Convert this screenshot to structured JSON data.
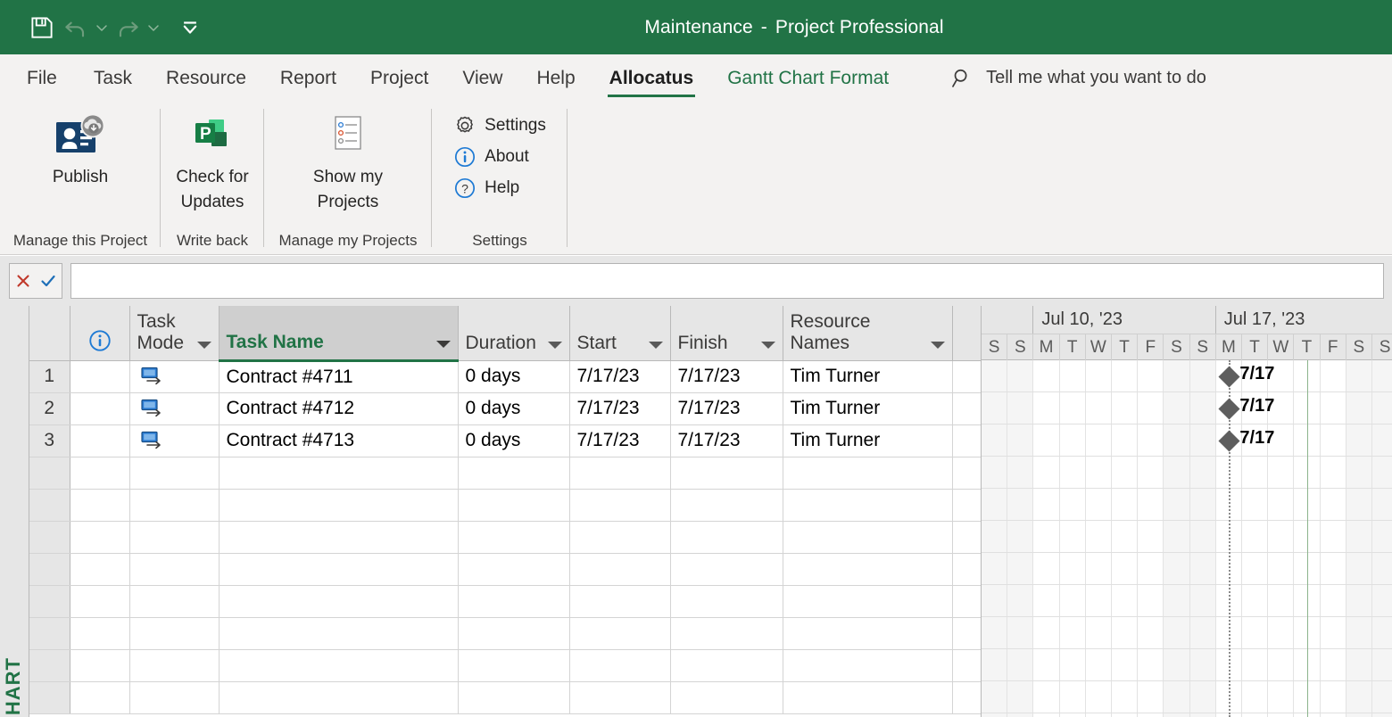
{
  "titlebar": {
    "doc_name": "Maintenance",
    "separator": "-",
    "app_name": "Project Professional",
    "quick_access": [
      {
        "name": "save-button",
        "icon": "save-icon"
      },
      {
        "name": "undo-button",
        "icon": "undo-icon"
      },
      {
        "name": "undo-dropdown",
        "icon": "chevron-down-icon"
      },
      {
        "name": "redo-button",
        "icon": "redo-icon"
      },
      {
        "name": "redo-dropdown",
        "icon": "chevron-down-icon"
      },
      {
        "name": "customize-quick-access-toolbar",
        "icon": "overflow-chevron-icon"
      }
    ]
  },
  "tabs": [
    {
      "label": "File",
      "state": "normal"
    },
    {
      "label": "Task",
      "state": "normal"
    },
    {
      "label": "Resource",
      "state": "normal"
    },
    {
      "label": "Report",
      "state": "normal"
    },
    {
      "label": "Project",
      "state": "normal"
    },
    {
      "label": "View",
      "state": "normal"
    },
    {
      "label": "Help",
      "state": "normal"
    },
    {
      "label": "Allocatus",
      "state": "active"
    },
    {
      "label": "Gantt Chart Format",
      "state": "contextual"
    }
  ],
  "tell_me": {
    "placeholder": "Tell me what you want to do",
    "icon": "search-icon"
  },
  "ribbon": {
    "groups": [
      {
        "label": "Manage this Project",
        "buttons": [
          {
            "label": "Publish",
            "icon": "publish-cloud-icon",
            "size": "large"
          }
        ]
      },
      {
        "label": "Write back",
        "buttons": [
          {
            "label": "Check for\nUpdates",
            "icon": "project-app-icon",
            "size": "large"
          }
        ]
      },
      {
        "label": "Manage my Projects",
        "buttons": [
          {
            "label": "Show my\nProjects",
            "icon": "list-document-icon",
            "size": "large"
          }
        ]
      },
      {
        "label": "Settings",
        "buttons": [
          {
            "label": "Settings",
            "icon": "gear-icon",
            "size": "small"
          },
          {
            "label": "About",
            "icon": "info-icon",
            "size": "small"
          },
          {
            "label": "Help",
            "icon": "question-icon",
            "size": "small"
          }
        ]
      }
    ]
  },
  "entry_bar": {
    "cancel_icon": "cancel-x-icon",
    "confirm_icon": "confirm-check-icon",
    "value": "",
    "placeholder": ""
  },
  "side_strip": {
    "view_label": "HART"
  },
  "grid": {
    "columns": [
      {
        "key": "rownum",
        "label": "",
        "has_dropdown": false,
        "selected": false
      },
      {
        "key": "info",
        "label": "",
        "icon": "info-circle-icon",
        "has_dropdown": false,
        "selected": false
      },
      {
        "key": "mode",
        "label": "Task\nMode",
        "has_dropdown": true,
        "selected": false
      },
      {
        "key": "name",
        "label": "Task Name",
        "has_dropdown": true,
        "selected": true
      },
      {
        "key": "duration",
        "label": "Duration",
        "has_dropdown": true,
        "selected": false
      },
      {
        "key": "start",
        "label": "Start",
        "has_dropdown": true,
        "selected": false
      },
      {
        "key": "finish",
        "label": "Finish",
        "has_dropdown": true,
        "selected": false
      },
      {
        "key": "resource",
        "label": "Resource Names",
        "has_dropdown": true,
        "selected": false
      }
    ],
    "rows": [
      {
        "rownum": "1",
        "mode_icon": "auto-scheduled-icon",
        "name": "Contract #4711",
        "duration": "0 days",
        "start": "7/17/23",
        "finish": "7/17/23",
        "resource": "Tim Turner"
      },
      {
        "rownum": "2",
        "mode_icon": "auto-scheduled-icon",
        "name": "Contract #4712",
        "duration": "0 days",
        "start": "7/17/23",
        "finish": "7/17/23",
        "resource": "Tim Turner"
      },
      {
        "rownum": "3",
        "mode_icon": "auto-scheduled-icon",
        "name": "Contract #4713",
        "duration": "0 days",
        "start": "7/17/23",
        "finish": "7/17/23",
        "resource": "Tim Turner"
      }
    ],
    "empty_row_count": 8
  },
  "gantt": {
    "weeks": [
      {
        "label": "Jul 10, '23",
        "start_day_index": 2
      },
      {
        "label": "Jul 17, '23",
        "start_day_index": 9
      }
    ],
    "days": [
      {
        "letter": "S",
        "weekend": true
      },
      {
        "letter": "S",
        "weekend": true
      },
      {
        "letter": "M",
        "weekend": false
      },
      {
        "letter": "T",
        "weekend": false
      },
      {
        "letter": "W",
        "weekend": false
      },
      {
        "letter": "T",
        "weekend": false
      },
      {
        "letter": "F",
        "weekend": false
      },
      {
        "letter": "S",
        "weekend": true
      },
      {
        "letter": "S",
        "weekend": true
      },
      {
        "letter": "M",
        "weekend": false
      },
      {
        "letter": "T",
        "weekend": false
      },
      {
        "letter": "W",
        "weekend": false
      },
      {
        "letter": "T",
        "weekend": false
      },
      {
        "letter": "F",
        "weekend": false
      },
      {
        "letter": "S",
        "weekend": true
      },
      {
        "letter": "S",
        "weekend": true
      }
    ],
    "bars": [
      {
        "type": "milestone",
        "day_index": 9,
        "label": "7/17",
        "row": 0
      },
      {
        "type": "milestone",
        "day_index": 9,
        "label": "7/17",
        "row": 1
      },
      {
        "type": "milestone",
        "day_index": 9,
        "label": "7/17",
        "row": 2
      }
    ],
    "today_line_day_index": 9,
    "status_line_day_index": 12
  },
  "colors": {
    "brand_green": "#217346",
    "ribbon_bg": "#f3f2f1",
    "header_gray": "#e6e6e6",
    "selected_header": "#cfcfcf",
    "milestone": "#5e5e5e",
    "task_mode_blue": "#2b7cd3"
  }
}
